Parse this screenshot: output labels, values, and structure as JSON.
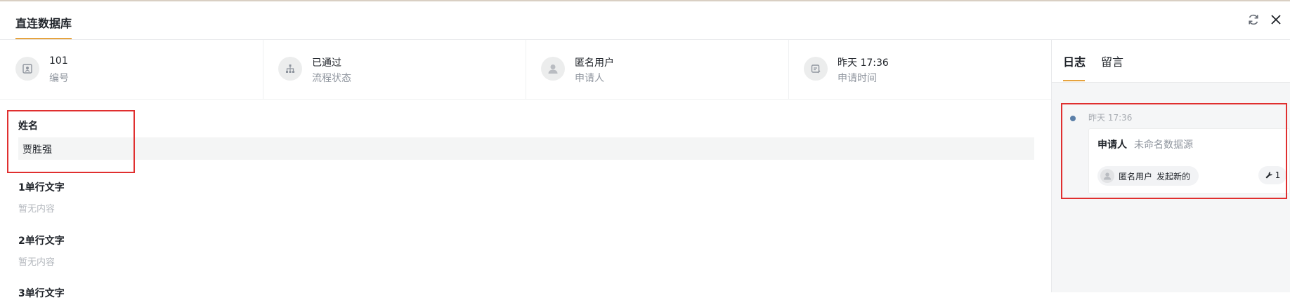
{
  "header": {
    "title": "直连数据库"
  },
  "info": [
    {
      "value": "101",
      "label": "编号",
      "icon": "id-badge-icon"
    },
    {
      "value": "已通过",
      "label": "流程状态",
      "icon": "org-chart-icon"
    },
    {
      "value": "匿名用户",
      "label": "申请人",
      "icon": "user-avatar-icon"
    },
    {
      "value": "昨天 17:36",
      "label": "申请时间",
      "icon": "calendar-edit-icon"
    }
  ],
  "form": {
    "name_label": "姓名",
    "name_value": "贾胜强",
    "fields": [
      {
        "label": "1单行文字",
        "value": "暂无内容"
      },
      {
        "label": "2单行文字",
        "value": "暂无内容"
      },
      {
        "label": "3单行文字"
      }
    ]
  },
  "side": {
    "tabs": [
      "日志",
      "留言"
    ],
    "log": {
      "time": "昨天 17:36",
      "applicant_key": "申请人",
      "applicant_value": "未命名数据源",
      "user": "匿名用户",
      "action": "发起新的",
      "count": "1"
    }
  },
  "colors": {
    "accent": "#e6a33e",
    "highlight": "#e02f2f",
    "timeline_dot": "#5b7fa8"
  }
}
